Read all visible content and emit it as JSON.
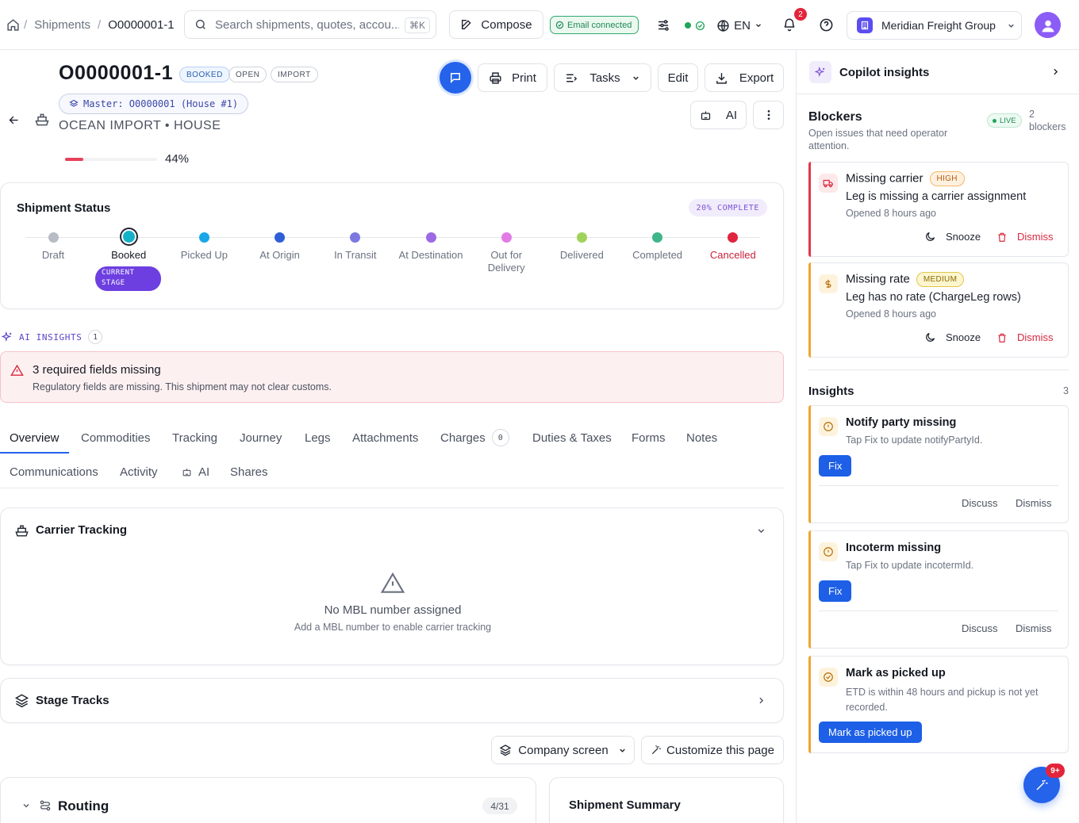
{
  "breadcrumb": {
    "section": "Shipments",
    "current": "O0000001-1"
  },
  "search": {
    "placeholder": "Search shipments, quotes, accou...",
    "shortcut": "⌘K"
  },
  "compose_label": "Compose",
  "email_status": "Email connected",
  "language": "EN",
  "notification_count": "2",
  "organization": "Meridian Freight Group",
  "shipment": {
    "id": "O0000001-1",
    "tags": [
      "BOOKED",
      "OPEN",
      "IMPORT"
    ],
    "master": "Master: O0000001 (House #1)",
    "subtitle": "OCEAN IMPORT • HOUSE",
    "progress_label": "44%",
    "progress_value": 0.44
  },
  "actions": {
    "print": "Print",
    "tasks": "Tasks",
    "edit": "Edit",
    "export": "Export",
    "ai": "AI"
  },
  "status": {
    "title": "Shipment Status",
    "complete": "20% COMPLETE",
    "current_stage_label": "CURRENT STAGE",
    "stages": [
      {
        "label": "Draft",
        "color": "#b7bcc5"
      },
      {
        "label": "Booked",
        "color": "#15b3c9"
      },
      {
        "label": "Picked Up",
        "color": "#1aa7e8"
      },
      {
        "label": "At Origin",
        "color": "#2f5fd6"
      },
      {
        "label": "In Transit",
        "color": "#7b78e0"
      },
      {
        "label": "At Destination",
        "color": "#9b6ae4"
      },
      {
        "label": "Out for Delivery",
        "color": "#e37be6"
      },
      {
        "label": "Delivered",
        "color": "#9fd35b"
      },
      {
        "label": "Completed",
        "color": "#3fb58a"
      },
      {
        "label": "Cancelled",
        "color": "#e0243f"
      }
    ]
  },
  "ai_insights": {
    "label": "AI INSIGHTS",
    "count": "1",
    "alert_title": "3 required fields missing",
    "alert_text": "Regulatory fields are missing. This shipment may not clear customs."
  },
  "tabs": {
    "row1": [
      "Overview",
      "Commodities",
      "Tracking",
      "Journey",
      "Legs",
      "Attachments",
      "Charges",
      "Duties & Taxes",
      "Forms",
      "Notes"
    ],
    "charges_count": "0",
    "row2": [
      "Communications",
      "Activity",
      "AI",
      "Shares"
    ]
  },
  "carrier_tracking": {
    "title": "Carrier Tracking",
    "empty_title": "No MBL number assigned",
    "empty_text": "Add a MBL number to enable carrier tracking"
  },
  "stage_tracks": {
    "title": "Stage Tracks"
  },
  "company_screen": "Company screen",
  "customize": "Customize this page",
  "routing": {
    "title": "Routing",
    "count": "4/31"
  },
  "summary": {
    "title": "Shipment Summary"
  },
  "copilot": {
    "title": "Copilot insights",
    "blockers_title": "Blockers",
    "blockers_sub": "Open issues that need operator attention.",
    "live": "LIVE",
    "blockers_count": "2",
    "blockers_word": "blockers",
    "blockers": [
      {
        "title": "Missing carrier",
        "severity": "HIGH",
        "text": "Leg is missing a carrier assignment",
        "time": "Opened 8 hours ago",
        "snooze": "Snooze",
        "dismiss": "Dismiss"
      },
      {
        "title": "Missing rate",
        "severity": "MEDIUM",
        "text": "Leg has no rate (ChargeLeg rows)",
        "time": "Opened 8 hours ago",
        "snooze": "Snooze",
        "dismiss": "Dismiss"
      }
    ],
    "insights_title": "Insights",
    "insights_count": "3",
    "insights": [
      {
        "title": "Notify party missing",
        "text": "Tap Fix to update notifyPartyId.",
        "fix": "Fix",
        "discuss": "Discuss",
        "dismiss": "Dismiss"
      },
      {
        "title": "Incoterm missing",
        "text": "Tap Fix to update incotermId.",
        "fix": "Fix",
        "discuss": "Discuss",
        "dismiss": "Dismiss"
      },
      {
        "title": "Mark as picked up",
        "text": "ETD is within 48 hours and pickup is not yet recorded.",
        "action": "Mark as picked up"
      }
    ],
    "fab_badge": "9+"
  }
}
